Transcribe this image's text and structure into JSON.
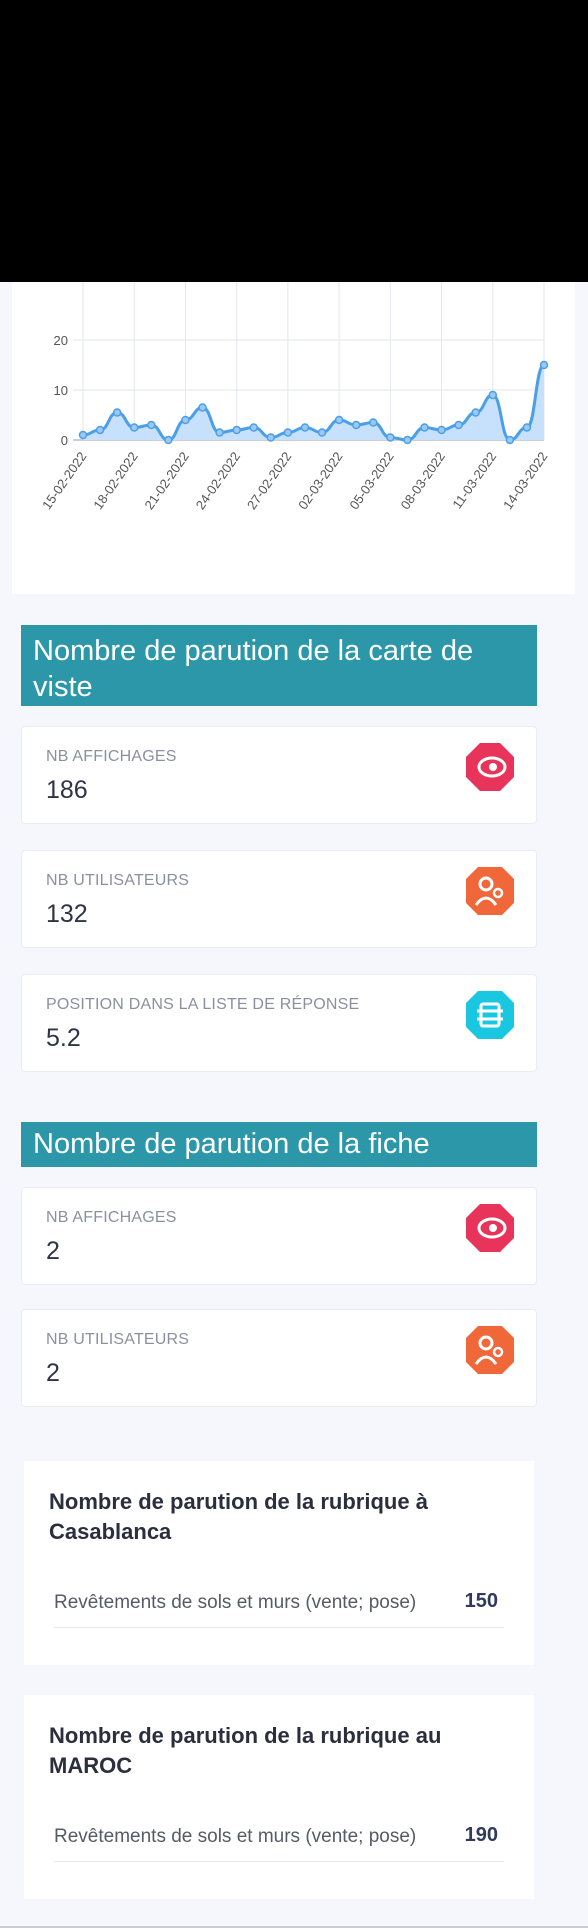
{
  "chart_data": {
    "type": "area",
    "title": "",
    "xlabel": "",
    "ylabel": "",
    "ylim": [
      0,
      25
    ],
    "yticks": [
      0,
      10,
      20
    ],
    "grid": true,
    "color": "#4a9fe8",
    "fill_color": "#c7e0fb",
    "x": [
      "15-02-2022",
      "16-02-2022",
      "17-02-2022",
      "18-02-2022",
      "19-02-2022",
      "20-02-2022",
      "21-02-2022",
      "22-02-2022",
      "23-02-2022",
      "24-02-2022",
      "25-02-2022",
      "26-02-2022",
      "27-02-2022",
      "28-02-2022",
      "01-03-2022",
      "02-03-2022",
      "03-03-2022",
      "04-03-2022",
      "05-03-2022",
      "06-03-2022",
      "07-03-2022",
      "08-03-2022",
      "09-03-2022",
      "10-03-2022",
      "11-03-2022",
      "12-03-2022",
      "13-03-2022",
      "14-03-2022"
    ],
    "xtick_labels": [
      "15-02-2022",
      "18-02-2022",
      "21-02-2022",
      "24-02-2022",
      "27-02-2022",
      "02-03-2022",
      "05-03-2022",
      "08-03-2022",
      "11-03-2022",
      "14-03-2022"
    ],
    "values": [
      1,
      2,
      5.5,
      2.5,
      3,
      0,
      4,
      6.5,
      1.5,
      2,
      2.5,
      0.5,
      1.5,
      2.5,
      1.5,
      4,
      3,
      3.5,
      0.5,
      0,
      2.5,
      2,
      3,
      5.5,
      9,
      0,
      2.5,
      15
    ]
  },
  "section1": {
    "title": "Nombre de parution de la carte de viste",
    "cards": [
      {
        "label": "NB AFFICHAGES",
        "value": "186",
        "icon": "eye-icon",
        "color": "#e8345a"
      },
      {
        "label": "NB UTILISATEURS",
        "value": "132",
        "icon": "users-icon",
        "color": "#f0683a"
      },
      {
        "label": "POSITION DANS LA LISTE DE RÉPONSE",
        "value": "5.2",
        "icon": "list-icon",
        "color": "#19c8e0"
      }
    ]
  },
  "section2": {
    "title": "Nombre de parution de la fiche",
    "cards": [
      {
        "label": "NB AFFICHAGES",
        "value": "2",
        "icon": "eye-icon",
        "color": "#e8345a"
      },
      {
        "label": "NB UTILISATEURS",
        "value": "2",
        "icon": "users-icon",
        "color": "#f0683a"
      }
    ]
  },
  "rubrique_casablanca": {
    "title": "Nombre de parution de la rubrique à Casablanca",
    "rows": [
      {
        "name": "Revêtements de sols et murs (vente; pose)",
        "count": "150"
      }
    ]
  },
  "rubrique_maroc": {
    "title": "Nombre de parution de la rubrique au MAROC",
    "rows": [
      {
        "name": "Revêtements de sols et murs (vente; pose)",
        "count": "190"
      }
    ]
  }
}
